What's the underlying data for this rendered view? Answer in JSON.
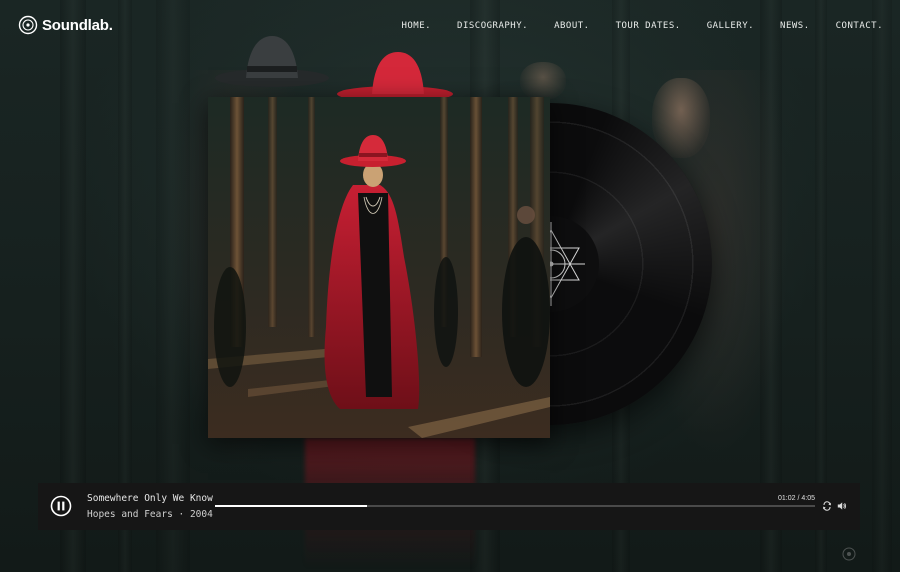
{
  "header": {
    "logo_text": "Soundlab.",
    "logo_icon": "vinyl-icon",
    "nav": [
      {
        "label": "HOME."
      },
      {
        "label": "DISCOGRAPHY."
      },
      {
        "label": "ABOUT."
      },
      {
        "label": "TOUR DATES."
      },
      {
        "label": "GALLERY."
      },
      {
        "label": "NEWS."
      },
      {
        "label": "CONTACT."
      }
    ]
  },
  "player": {
    "state_icon": "pause-icon",
    "track_title": "Somewhere Only We Know",
    "album_line": "Hopes and Fears · 2004",
    "time": "01:02 / 4:05",
    "progress_fraction": 0.2531,
    "repeat_icon": "repeat-icon",
    "volume_icon": "volume-icon"
  },
  "colors": {
    "accent_red": "#c01f2e",
    "background": "#141d1b",
    "player_bg": "#161616"
  }
}
